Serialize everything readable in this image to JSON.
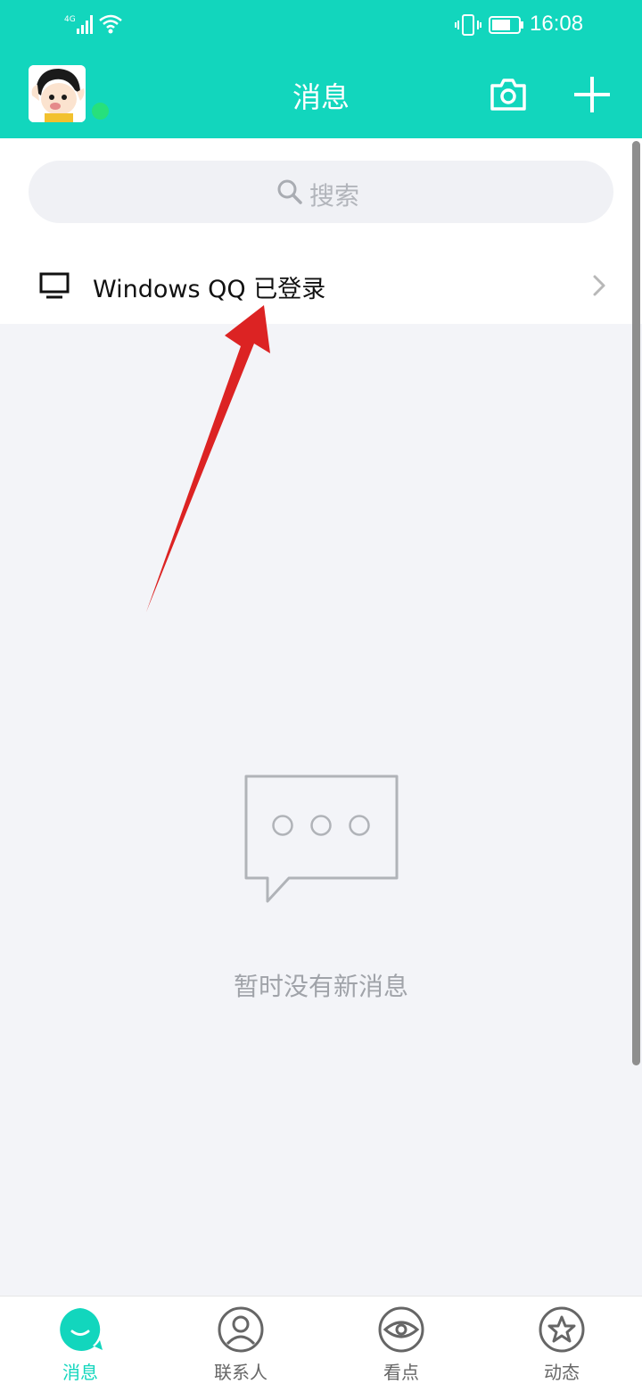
{
  "status_bar": {
    "network": "4G",
    "time": "16:08"
  },
  "header": {
    "title": "消息",
    "camera_icon": "camera-icon",
    "add_icon": "plus-icon",
    "online_status_color": "#27e07c"
  },
  "search": {
    "placeholder": "搜索"
  },
  "device_login": {
    "label": "Windows QQ 已登录"
  },
  "empty_state": {
    "message": "暂时没有新消息"
  },
  "tabbar": {
    "tabs": [
      {
        "label": "消息",
        "icon": "chat-bubble-icon",
        "active": true
      },
      {
        "label": "联系人",
        "icon": "contact-icon",
        "active": false
      },
      {
        "label": "看点",
        "icon": "eye-icon",
        "active": false
      },
      {
        "label": "动态",
        "icon": "star-icon",
        "active": false
      }
    ]
  },
  "colors": {
    "accent": "#12d6bd",
    "background": "#f3f4f8",
    "annotation_arrow": "#dc2323"
  }
}
